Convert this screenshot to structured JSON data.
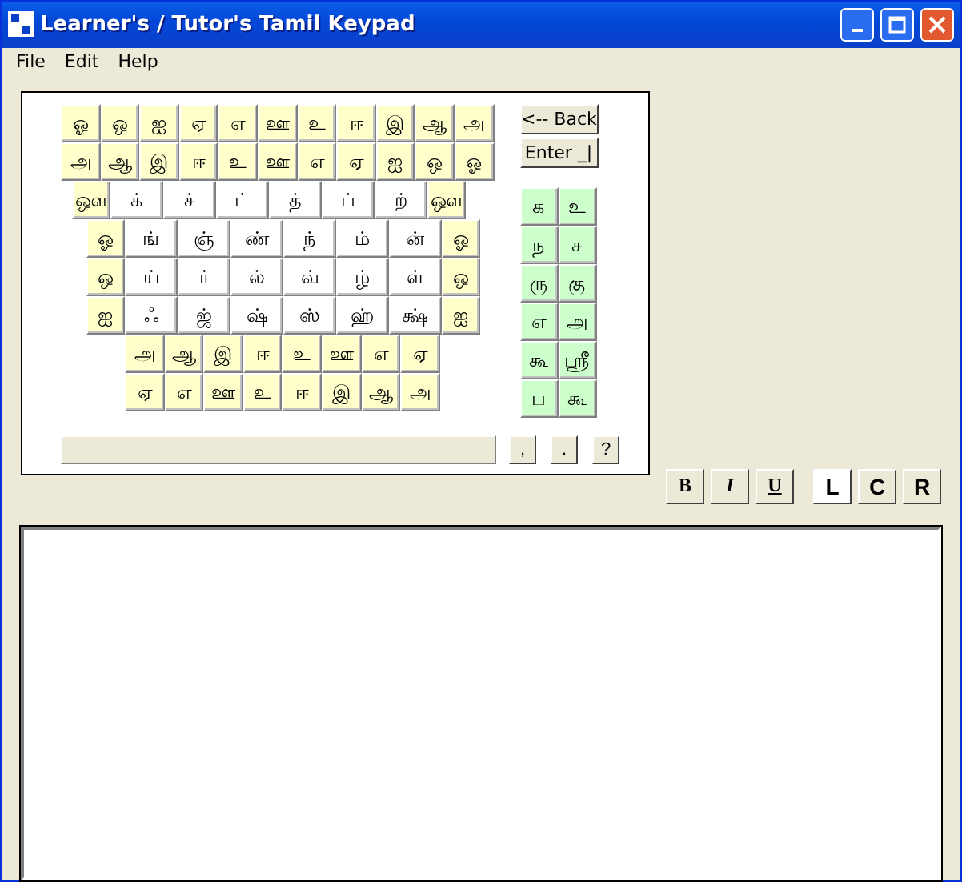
{
  "window": {
    "title": "Learner's / Tutor's Tamil Keypad"
  },
  "menu": [
    "File",
    "Edit",
    "Help"
  ],
  "keypad_rows": [
    {
      "keys": [
        {
          "label": "ஓ",
          "kind": "vowel"
        },
        {
          "label": "ஒ",
          "kind": "vowel"
        },
        {
          "label": "ஐ",
          "kind": "vowel"
        },
        {
          "label": "ஏ",
          "kind": "vowel"
        },
        {
          "label": "எ",
          "kind": "vowel"
        },
        {
          "label": "ஊ",
          "kind": "vowel"
        },
        {
          "label": "உ",
          "kind": "vowel"
        },
        {
          "label": "ஈ",
          "kind": "vowel"
        },
        {
          "label": "இ",
          "kind": "vowel"
        },
        {
          "label": "ஆ",
          "kind": "vowel"
        },
        {
          "label": "அ",
          "kind": "vowel"
        }
      ]
    },
    {
      "keys": [
        {
          "label": "அ",
          "kind": "vowel"
        },
        {
          "label": "ஆ",
          "kind": "vowel"
        },
        {
          "label": "இ",
          "kind": "vowel"
        },
        {
          "label": "ஈ",
          "kind": "vowel"
        },
        {
          "label": "உ",
          "kind": "vowel"
        },
        {
          "label": "ஊ",
          "kind": "vowel"
        },
        {
          "label": "எ",
          "kind": "vowel"
        },
        {
          "label": "ஏ",
          "kind": "vowel"
        },
        {
          "label": "ஐ",
          "kind": "vowel"
        },
        {
          "label": "ஒ",
          "kind": "vowel"
        },
        {
          "label": "ஓ",
          "kind": "vowel"
        }
      ]
    },
    {
      "keys": [
        {
          "label": "ஔ",
          "kind": "vowel"
        },
        {
          "label": "க்",
          "kind": "consonant"
        },
        {
          "label": "ச்",
          "kind": "consonant"
        },
        {
          "label": "ட்",
          "kind": "consonant"
        },
        {
          "label": "த்",
          "kind": "consonant"
        },
        {
          "label": "ப்",
          "kind": "consonant"
        },
        {
          "label": "ற்",
          "kind": "consonant"
        },
        {
          "label": "ஔ",
          "kind": "vowel"
        }
      ]
    },
    {
      "keys": [
        {
          "label": "ஓ",
          "kind": "vowel"
        },
        {
          "label": "ங்",
          "kind": "consonant"
        },
        {
          "label": "ஞ்",
          "kind": "consonant"
        },
        {
          "label": "ண்",
          "kind": "consonant"
        },
        {
          "label": "ந்",
          "kind": "consonant"
        },
        {
          "label": "ம்",
          "kind": "consonant"
        },
        {
          "label": "ன்",
          "kind": "consonant"
        },
        {
          "label": "ஓ",
          "kind": "vowel"
        }
      ]
    },
    {
      "keys": [
        {
          "label": "ஒ",
          "kind": "vowel"
        },
        {
          "label": "ய்",
          "kind": "consonant"
        },
        {
          "label": "ர்",
          "kind": "consonant"
        },
        {
          "label": "ல்",
          "kind": "consonant"
        },
        {
          "label": "வ்",
          "kind": "consonant"
        },
        {
          "label": "ழ்",
          "kind": "consonant"
        },
        {
          "label": "ள்",
          "kind": "consonant"
        },
        {
          "label": "ஒ",
          "kind": "vowel"
        }
      ]
    },
    {
      "keys": [
        {
          "label": "ஐ",
          "kind": "vowel"
        },
        {
          "label": "ஃ",
          "kind": "consonant"
        },
        {
          "label": "ஜ்",
          "kind": "consonant"
        },
        {
          "label": "ஷ்",
          "kind": "consonant"
        },
        {
          "label": "ஸ்",
          "kind": "consonant"
        },
        {
          "label": "ஹ்",
          "kind": "consonant"
        },
        {
          "label": "க்ஷ்",
          "kind": "consonant"
        },
        {
          "label": "ஐ",
          "kind": "vowel"
        }
      ]
    },
    {
      "keys": [
        {
          "label": "அ",
          "kind": "vowel"
        },
        {
          "label": "ஆ",
          "kind": "vowel"
        },
        {
          "label": "இ",
          "kind": "vowel"
        },
        {
          "label": "ஈ",
          "kind": "vowel"
        },
        {
          "label": "உ",
          "kind": "vowel"
        },
        {
          "label": "ஊ",
          "kind": "vowel"
        },
        {
          "label": "எ",
          "kind": "vowel"
        },
        {
          "label": "ஏ",
          "kind": "vowel"
        }
      ]
    },
    {
      "keys": [
        {
          "label": "ஏ",
          "kind": "vowel"
        },
        {
          "label": "எ",
          "kind": "vowel"
        },
        {
          "label": "ஊ",
          "kind": "vowel"
        },
        {
          "label": "உ",
          "kind": "vowel"
        },
        {
          "label": "ஈ",
          "kind": "vowel"
        },
        {
          "label": "இ",
          "kind": "vowel"
        },
        {
          "label": "ஆ",
          "kind": "vowel"
        },
        {
          "label": "அ",
          "kind": "vowel"
        }
      ]
    }
  ],
  "back_button": "<-- Back",
  "enter_button": "Enter _|",
  "sign_keys": [
    "க",
    "உ",
    "ந",
    "ச",
    "ரு",
    "கு",
    "எ",
    "அ",
    "கூ",
    "ஸ்ரீ",
    "ப",
    "கூ"
  ],
  "punctuation_keys": [
    ",",
    ".",
    "?"
  ],
  "style_buttons": [
    {
      "label": "B",
      "kind": "bold"
    },
    {
      "label": "I",
      "kind": "italic"
    },
    {
      "label": "U",
      "kind": "underline"
    }
  ],
  "align_buttons": [
    {
      "label": "L",
      "selected": true
    },
    {
      "label": "C",
      "selected": false
    },
    {
      "label": "R",
      "selected": false
    }
  ]
}
